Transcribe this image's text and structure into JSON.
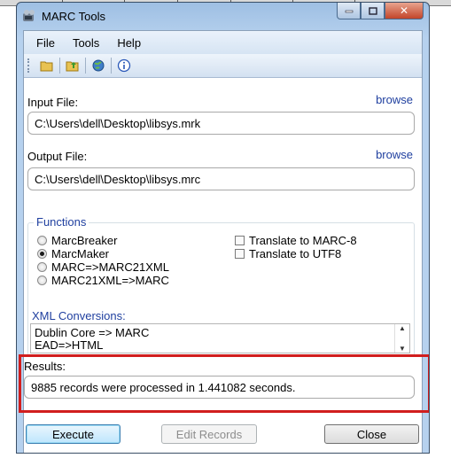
{
  "window": {
    "title": "MARC Tools"
  },
  "menu": [
    "File",
    "Tools",
    "Help"
  ],
  "toolbar": {
    "icons": [
      "open-folder-icon",
      "save-folder-icon",
      "globe-icon",
      "info-icon"
    ]
  },
  "input": {
    "label": "Input File:",
    "browse": "browse",
    "value": "C:\\Users\\dell\\Desktop\\libsys.mrk"
  },
  "output": {
    "label": "Output File:",
    "browse": "browse",
    "value": "C:\\Users\\dell\\Desktop\\libsys.mrc"
  },
  "functions": {
    "title": "Functions",
    "radios": [
      {
        "label": "MarcBreaker",
        "selected": false
      },
      {
        "label": "MarcMaker",
        "selected": true
      },
      {
        "label": "MARC=>MARC21XML",
        "selected": false
      },
      {
        "label": "MARC21XML=>MARC",
        "selected": false
      }
    ],
    "checks": [
      {
        "label": "Translate to MARC-8",
        "checked": false
      },
      {
        "label": "Translate to UTF8",
        "checked": false
      }
    ],
    "xml_title": "XML Conversions:",
    "xml_items": [
      "Dublin Core => MARC",
      "EAD=>HTML"
    ]
  },
  "results": {
    "label": "Results:",
    "value": "9885 records were processed in 1.441082 seconds."
  },
  "buttons": {
    "execute": "Execute",
    "edit": "Edit Records",
    "close": "Close"
  },
  "colors": {
    "accent": "#1f3f9f",
    "highlight": "#d11e1e"
  }
}
